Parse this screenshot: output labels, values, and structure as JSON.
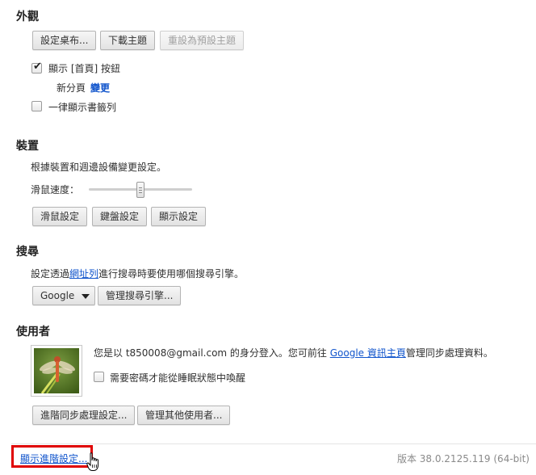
{
  "appearance": {
    "title": "外觀",
    "set_wallpaper": "設定桌布...",
    "get_themes": "下載主題",
    "reset_theme": "重設為預設主題",
    "show_home_label": "顯示 [首頁] 按鈕",
    "show_home_checked": true,
    "new_tab_label": "新分頁",
    "change_link": "變更",
    "show_bookmarks_label": "一律顯示書籤列",
    "show_bookmarks_checked": false
  },
  "devices": {
    "title": "裝置",
    "description": "根據裝置和週邊設備變更設定。",
    "mouse_speed_label": "滑鼠速度：",
    "mouse_speed_fraction": 0.5,
    "mouse_settings": "滑鼠設定",
    "keyboard_settings": "鍵盤設定",
    "display_settings": "顯示設定"
  },
  "search": {
    "title": "搜尋",
    "desc_prefix": "設定透過",
    "omnibox_link": "網址列",
    "desc_suffix": "進行搜尋時要使用哪個搜尋引擎。",
    "engine_selected": "Google",
    "manage_engines": "管理搜尋引擎..."
  },
  "users": {
    "title": "使用者",
    "signed_in_prefix": "您是以 t850008@gmail.com 的身分登入。您可前往 ",
    "dashboard_link": "Google 資訊主頁",
    "signed_in_suffix": "管理同步處理資料。",
    "require_password_label": "需要密碼才能從睡眠狀態中喚醒",
    "require_password_checked": false,
    "advanced_sync": "進階同步處理設定...",
    "manage_users": "管理其他使用者..."
  },
  "footer": {
    "show_advanced": "顯示進階設定...",
    "version": "版本 38.0.2125.119 (64-bit)"
  },
  "colors": {
    "link": "#1155cc",
    "highlight_box": "#e00000"
  }
}
